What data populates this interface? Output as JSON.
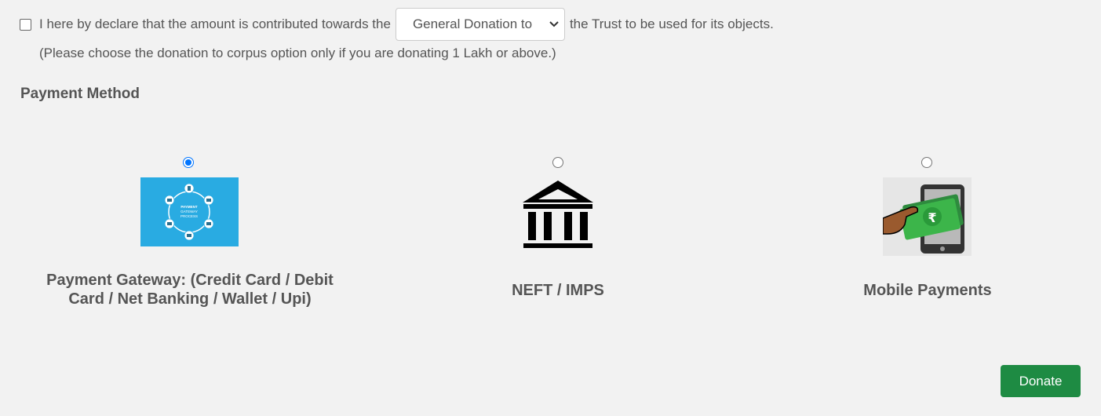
{
  "declaration": {
    "text_before": "I here by declare that the amount is contributed towards the",
    "selected_option": "General Donation to",
    "text_after": "the Trust to be used for its objects.",
    "checked": false
  },
  "note": "(Please choose the donation to corpus option only if you are donating 1 Lakh or above.)",
  "payment": {
    "title": "Payment Method",
    "options": [
      {
        "label_line1": "Payment Gateway: (Credit Card / Debit",
        "label_line2": "Card / Net Banking / Wallet / Upi)",
        "image_text": [
          "PAYMENT",
          "GATEWAY",
          "PROCESS"
        ],
        "selected": true
      },
      {
        "label": "NEFT / IMPS",
        "selected": false
      },
      {
        "label": "Mobile Payments",
        "selected": false
      }
    ]
  },
  "donate_button": "Donate",
  "colors": {
    "background": "#f2f2f2",
    "text": "#555555",
    "radio_selected": "#0075ff",
    "donate_button": "#1e8b43",
    "gateway_image_bg": "#29abe2",
    "cash_green": "#3cb54a"
  },
  "icons": [
    "chevron-down-icon",
    "payment-gateway-icon",
    "bank-icon",
    "mobile-payment-icon",
    "rupee-icon"
  ]
}
